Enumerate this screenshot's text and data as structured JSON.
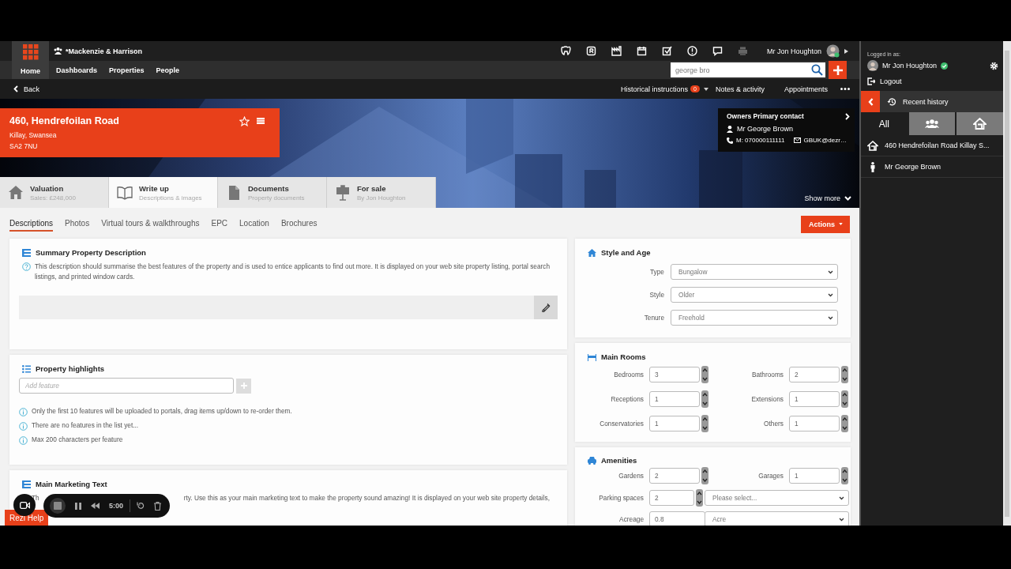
{
  "header": {
    "brand": "*Mackenzie & Harrison",
    "user": "Mr Jon Houghton"
  },
  "nav": [
    {
      "label": "Home",
      "selected": true
    },
    {
      "label": "Dashboards",
      "selected": false
    },
    {
      "label": "Properties",
      "selected": false
    },
    {
      "label": "People",
      "selected": false
    }
  ],
  "search": {
    "value": "george bro"
  },
  "subbar": {
    "back": "Back",
    "links": [
      {
        "label": "Historical instructions",
        "badge": "0",
        "kind": "dropdown"
      },
      {
        "label": "Notes & activity",
        "kind": "link"
      },
      {
        "label": "Appointments",
        "kind": "link"
      }
    ]
  },
  "property": {
    "title": "460, Hendrefoilan Road",
    "lines": [
      "Killay, Swansea",
      "SA2 7NU"
    ]
  },
  "contact": {
    "heading": "Owners Primary contact",
    "name": "Mr George Brown",
    "phone": "M: 070000111111",
    "email": "GBUK@dezr…"
  },
  "property_tabs": [
    {
      "kind": "house",
      "title": "Valuation",
      "subtitle": "Sales: £248,000",
      "selected": false
    },
    {
      "kind": "book",
      "title": "Write up",
      "subtitle": "Descriptions & images",
      "selected": true
    },
    {
      "kind": "document",
      "title": "Documents",
      "subtitle": "Property documents",
      "selected": false
    },
    {
      "kind": "sign",
      "title": "For sale",
      "subtitle": "By Jon Houghton",
      "selected": false
    }
  ],
  "show_more": "Show more",
  "subtabs": [
    {
      "label": "Descriptions",
      "selected": true
    },
    {
      "label": "Photos",
      "selected": false
    },
    {
      "label": "Virtual tours & walkthroughs",
      "selected": false
    },
    {
      "label": "EPC",
      "selected": false
    },
    {
      "label": "Location",
      "selected": false
    },
    {
      "label": "Brochures",
      "selected": false
    }
  ],
  "actions": "Actions",
  "summary": {
    "title": "Summary Property Description",
    "help": "This description should summarise the best features of the property and is used to entice applicants to find out more. It is displayed on your web site property listing, portal search listings, and printed window cards."
  },
  "highlights": {
    "title": "Property highlights",
    "placeholder": "Add feature",
    "notes": [
      "Only the first 10 features will be uploaded to portals, drag items up/down to re-order them.",
      "There are no features in the list yet...",
      "Max 200 characters per feature"
    ]
  },
  "marketing": {
    "title": "Main Marketing Text",
    "help_start": "Th",
    "help_end": "rty. Use this as your main marketing text to make the property sound amazing! It is displayed on your web site property details,"
  },
  "style_age": {
    "title": "Style and Age",
    "fields": [
      {
        "label": "Type",
        "value": "Bungalow"
      },
      {
        "label": "Style",
        "value": "Older"
      },
      {
        "label": "Tenure",
        "value": "Freehold"
      }
    ]
  },
  "main_rooms": {
    "title": "Main Rooms",
    "fields": [
      {
        "label": "Bedrooms",
        "value": "3"
      },
      {
        "label": "Bathrooms",
        "value": "2"
      },
      {
        "label": "Receptions",
        "value": "1"
      },
      {
        "label": "Extensions",
        "value": "1"
      },
      {
        "label": "Conservatories",
        "value": "1"
      },
      {
        "label": "Others",
        "value": "1"
      }
    ]
  },
  "amenities": {
    "title": "Amenities",
    "fields": [
      {
        "kind": "number",
        "label": "Gardens",
        "value": "2"
      },
      {
        "kind": "number",
        "label": "Garages",
        "value": "1"
      },
      {
        "kind": "number_select",
        "label": "Parking spaces",
        "value": "2",
        "select": "Please select..."
      },
      {
        "kind": "text_select",
        "label": "Acreage",
        "value": "0.8",
        "select": "Acre"
      }
    ]
  },
  "sidebar": {
    "logged_in_label": "Logged in as:",
    "user": "Mr Jon Houghton",
    "logout": "Logout",
    "recent": "Recent history",
    "filters": [
      {
        "kind": "all",
        "label": "All",
        "selected": true
      },
      {
        "kind": "people",
        "selected": false
      },
      {
        "kind": "house",
        "selected": false
      }
    ],
    "history": [
      {
        "kind": "property",
        "label": "460 Hendrefoilan Road Killay S..."
      },
      {
        "kind": "person",
        "label": "Mr George Brown"
      }
    ]
  },
  "help_button": "Rezi Help",
  "recorder": {
    "time": "5:00"
  }
}
